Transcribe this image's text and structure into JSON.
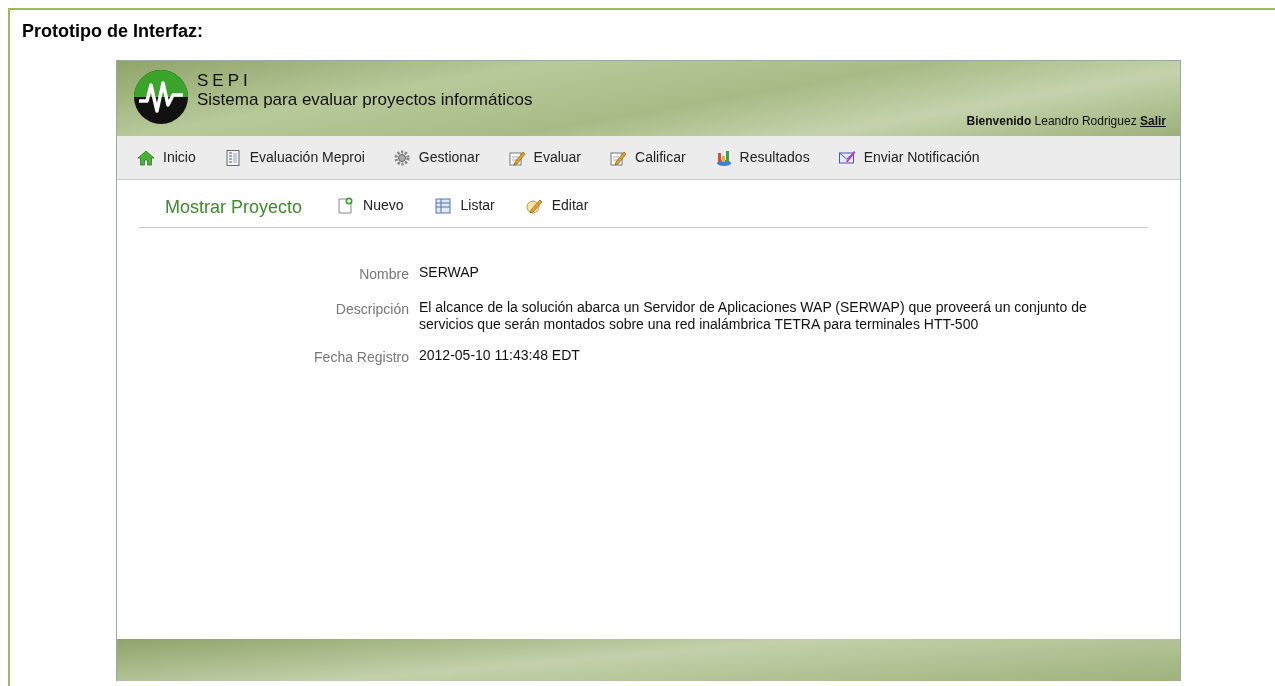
{
  "document": {
    "heading": "Prototipo de Interfaz:"
  },
  "app": {
    "logo_title": "SEPI",
    "subtitle": "Sistema para evaluar proyectos informáticos",
    "welcome": {
      "label": "Bienvenido",
      "user": "Leandro Rodriguez",
      "logout": "Salir"
    }
  },
  "menu": [
    {
      "label": "Inicio"
    },
    {
      "label": "Evaluación Meproi"
    },
    {
      "label": "Gestionar"
    },
    {
      "label": "Evaluar"
    },
    {
      "label": "Calificar"
    },
    {
      "label": "Resultados"
    },
    {
      "label": "Enviar Notificación"
    }
  ],
  "page": {
    "title": "Mostrar Proyecto",
    "actions": [
      {
        "label": "Nuevo"
      },
      {
        "label": "Listar"
      },
      {
        "label": "Editar"
      }
    ],
    "fields": [
      {
        "label": "Nombre",
        "value": "SERWAP"
      },
      {
        "label": "Descripción",
        "value": "El alcance de la solución abarca un Servidor de Aplicaciones WAP (SERWAP) que proveerá un conjunto de servicios que serán montados sobre una red inalámbrica TETRA para terminales HTT-500"
      },
      {
        "label": "Fecha Registro",
        "value": "2012-05-10 11:43:48 EDT"
      }
    ]
  }
}
